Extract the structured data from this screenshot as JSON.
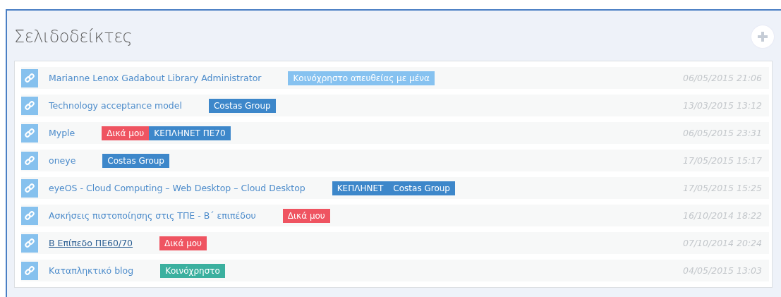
{
  "panel": {
    "title": "Σελιδοδείκτες"
  },
  "bookmarks": [
    {
      "title": "Marianne Lenox Gadabout Library Administrator",
      "hovered": false,
      "tags": [
        {
          "label": "Κοινόχρηστο απευθείας με μένα",
          "color": "#86c2f0"
        }
      ],
      "date": "06/05/2015 21:06"
    },
    {
      "title": "Technology acceptance model",
      "hovered": false,
      "tags": [
        {
          "label": "Costas Group",
          "color": "#3d87ca"
        }
      ],
      "date": "13/03/2015 13:12"
    },
    {
      "title": "Myple",
      "hovered": false,
      "tags": [
        {
          "label": "Δικά μου",
          "color": "#ef5461"
        },
        {
          "label": "ΚΕΠΛΗΝΕΤ   ΠΕ70",
          "color": "#3d87ca"
        }
      ],
      "date": "06/05/2015 23:31"
    },
    {
      "title": "oneye",
      "hovered": false,
      "tags": [
        {
          "label": "Costas Group",
          "color": "#3d87ca"
        }
      ],
      "date": "17/05/2015 15:17"
    },
    {
      "title": "eyeOS - Cloud Computing – Web Desktop – Cloud Desktop",
      "hovered": false,
      "tags": [
        {
          "label": "ΚΕΠΛΗΝΕΤ",
          "color": "#3d87ca"
        },
        {
          "label": "Costas Group",
          "color": "#3d87ca"
        }
      ],
      "date": "17/05/2015 15:25"
    },
    {
      "title": "Ασκήσεις πιστοποίησης στις ΤΠΕ - Β΄ επιπέδου",
      "hovered": false,
      "tags": [
        {
          "label": "Δικά μου",
          "color": "#ef5461"
        }
      ],
      "date": "16/10/2014 18:22"
    },
    {
      "title": "Β Επίπεδο ΠΕ60/70",
      "hovered": true,
      "tags": [
        {
          "label": "Δικά μου",
          "color": "#ef5461"
        }
      ],
      "date": "07/10/2014 20:24"
    },
    {
      "title": "Καταπληκτικό blog",
      "hovered": false,
      "tags": [
        {
          "label": "Κοινόχρηστο",
          "color": "#3bb09f"
        }
      ],
      "date": "04/05/2015 13:03"
    }
  ]
}
